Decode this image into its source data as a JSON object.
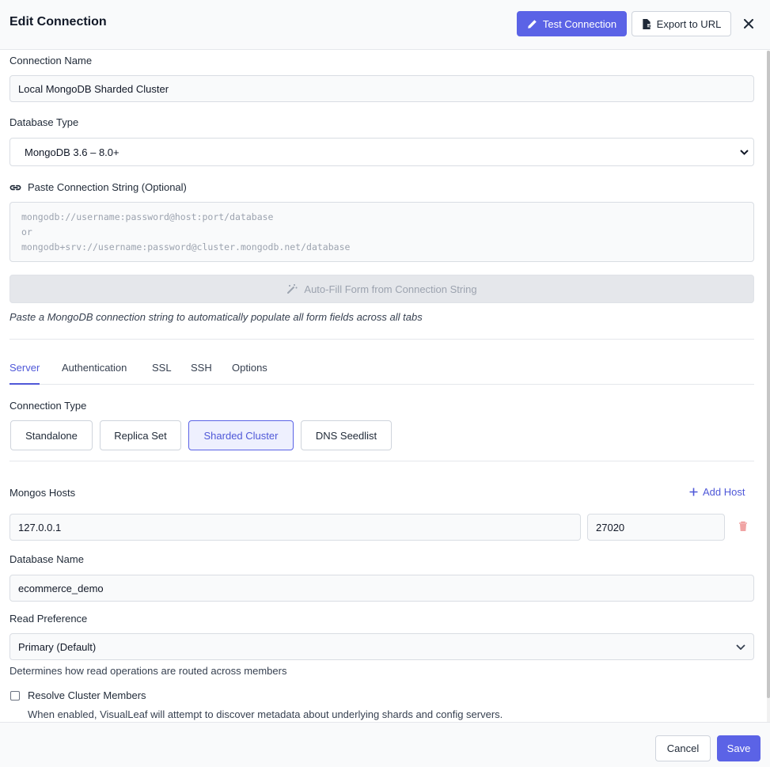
{
  "header": {
    "title": "Edit Connection",
    "test_connection_label": "Test Connection",
    "export_label": "Export to URL"
  },
  "form": {
    "connection_name_label": "Connection Name",
    "connection_name_value": "Local MongoDB Sharded Cluster",
    "database_type_label": "Database Type",
    "database_type_value": "MongoDB 3.6 – 8.0+",
    "paste_label": "Paste Connection String (Optional)",
    "paste_placeholder_lines": [
      "mongodb://username:password@host:port/database",
      "or",
      "mongodb+srv://username:password@cluster.mongodb.net/database"
    ],
    "autofill_label": "Auto-Fill Form from Connection String",
    "autofill_hint": "Paste a MongoDB connection string to automatically populate all form fields across all tabs"
  },
  "tabs": [
    {
      "label": "Server",
      "active": true
    },
    {
      "label": "Authentication",
      "active": false
    },
    {
      "label": "SSL",
      "active": false
    },
    {
      "label": "SSH",
      "active": false
    },
    {
      "label": "Options",
      "active": false
    }
  ],
  "server": {
    "connection_type_label": "Connection Type",
    "connection_types": [
      {
        "label": "Standalone",
        "active": false
      },
      {
        "label": "Replica Set",
        "active": false
      },
      {
        "label": "Sharded Cluster",
        "active": true
      },
      {
        "label": "DNS Seedlist",
        "active": false
      }
    ],
    "mongos_hosts_label": "Mongos Hosts",
    "add_host_label": "Add Host",
    "hosts": [
      {
        "host": "127.0.0.1",
        "port": "27020"
      }
    ],
    "database_name_label": "Database Name",
    "database_name_value": "ecommerce_demo",
    "read_preference_label": "Read Preference",
    "read_preference_value": "Primary (Default)",
    "read_preference_hint": "Determines how read operations are routed across members",
    "resolve_label": "Resolve Cluster Members",
    "resolve_checked": false,
    "resolve_hint": "When enabled, VisualLeaf will attempt to discover metadata about underlying shards and config servers."
  },
  "footer": {
    "cancel_label": "Cancel",
    "save_label": "Save"
  },
  "colors": {
    "accent": "#5b63e6",
    "danger_icon": "#f0a3a3"
  }
}
